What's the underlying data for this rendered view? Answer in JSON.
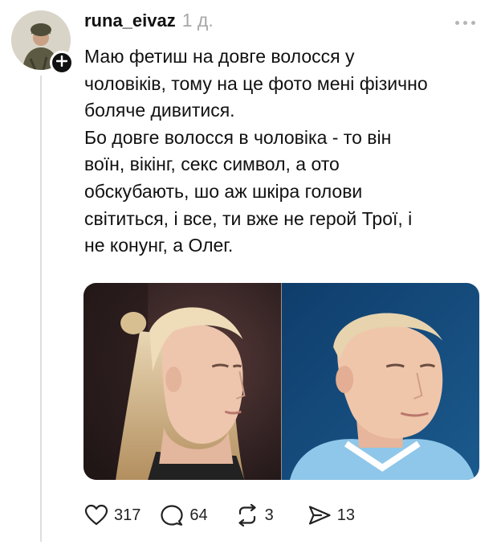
{
  "post": {
    "username": "runa_eivaz",
    "time": "1 д.",
    "text_lines": [
      "Маю фетиш на довге волосся у",
      "чоловіків, тому на це фото мені фізично",
      "боляче дивитися.",
      "Бо довге волосся в чоловіка - то він",
      "воїн, вікінг, секс символ, а ото",
      "обскубають, шо аж шкіра голови",
      "світиться, і все, ти вже не герой Трої, і",
      "не конунг, а Олег."
    ],
    "media": [
      {
        "description_icon": "photo-long-hair-man"
      },
      {
        "description_icon": "photo-short-hair-man"
      }
    ]
  },
  "actions": {
    "likes": "317",
    "replies": "64",
    "reposts": "3",
    "shares": "13"
  },
  "icons": {
    "like": "heart-icon",
    "reply": "comment-icon",
    "repost": "repost-icon",
    "share": "share-icon",
    "more": "more-icon",
    "follow": "plus-icon"
  },
  "colors": {
    "text": "#111111",
    "muted": "#a8a8a8",
    "thread_line": "#dedede"
  }
}
